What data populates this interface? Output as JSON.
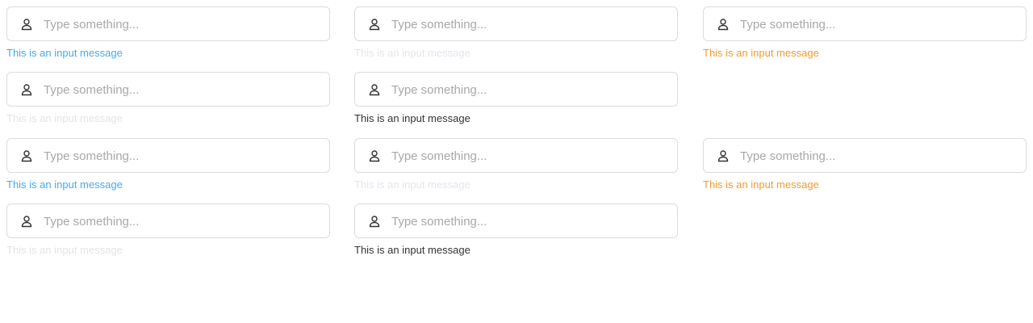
{
  "colors": {
    "info": "#42aaf0",
    "faint": "#e2e4e8",
    "warning": "#f29a30",
    "default": "#333333",
    "border": "#dcdcde",
    "placeholder": "#a8a8ab",
    "icon": "#333333"
  },
  "fields": [
    {
      "placeholder": "Type something...",
      "message": "This is an input message",
      "message_color": "#42aaf0",
      "icon": "user-icon"
    },
    {
      "placeholder": "Type something...",
      "message": "This is an input message",
      "message_color": "#e4e6ee",
      "icon": "user-icon"
    },
    {
      "placeholder": "Type something...",
      "message": "This is an input message",
      "message_color": "#f29a30",
      "icon": "user-icon"
    },
    {
      "placeholder": "Type something...",
      "message": "This is an input message",
      "message_color": "#e2e4e8",
      "icon": "user-icon"
    },
    {
      "placeholder": "Type something...",
      "message": "This is an input message",
      "message_color": "#333333",
      "icon": "user-icon"
    },
    {
      "placeholder": "Type something...",
      "message": "This is an input message",
      "message_color": "#42aaf0",
      "icon": "user-icon"
    },
    {
      "placeholder": "Type something...",
      "message": "This is an input message",
      "message_color": "#e4e6ee",
      "icon": "user-icon"
    },
    {
      "placeholder": "Type something...",
      "message": "This is an input message",
      "message_color": "#f29a30",
      "icon": "user-icon"
    },
    {
      "placeholder": "Type something...",
      "message": "This is an input message",
      "message_color": "#e2e4e8",
      "icon": "user-icon"
    },
    {
      "placeholder": "Type something...",
      "message": "This is an input message",
      "message_color": "#333333",
      "icon": "user-icon"
    }
  ]
}
